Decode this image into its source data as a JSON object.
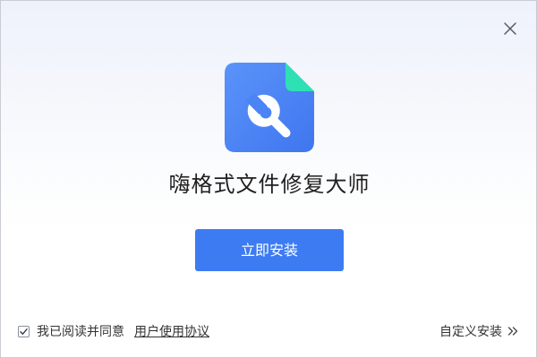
{
  "window": {
    "close_icon": "close-icon"
  },
  "app": {
    "icon": "document-wrench-icon",
    "title": "嗨格式文件修复大师"
  },
  "install_button": {
    "label": "立即安装"
  },
  "agreement": {
    "checked": true,
    "label": "我已阅读并同意",
    "link_label": "用户使用协议"
  },
  "custom_install": {
    "label": "自定义安装",
    "icon": "double-chevron-right-icon"
  },
  "colors": {
    "primary": "#3d7bf3",
    "icon_blue": "#4b85f7",
    "icon_fold": "#2fe0b4"
  }
}
